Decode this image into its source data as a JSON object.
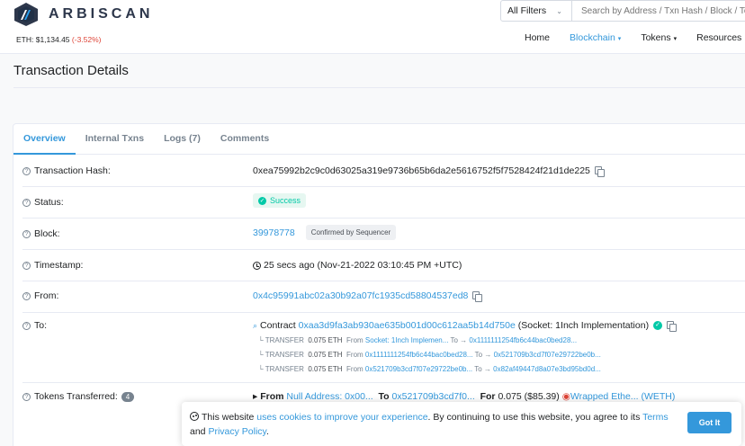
{
  "header": {
    "brand": "ARBISCAN",
    "eth_label": "ETH: $1,134.45",
    "eth_change": "(-3.52%)",
    "filter": "All Filters",
    "search_placeholder": "Search by Address / Txn Hash / Block / Token",
    "nav": [
      {
        "label": "Home"
      },
      {
        "label": "Blockchain"
      },
      {
        "label": "Tokens"
      },
      {
        "label": "Resources"
      }
    ]
  },
  "page": {
    "title": "Transaction Details"
  },
  "tabs": [
    {
      "label": "Overview"
    },
    {
      "label": "Internal Txns"
    },
    {
      "label": "Logs (7)"
    },
    {
      "label": "Comments"
    }
  ],
  "details": {
    "hash_label": "Transaction Hash:",
    "hash": "0xea75992b2c9c0d63025a319e9736b65b6da2e5616752f5f7528424f21d1de225",
    "status_label": "Status:",
    "status": "Success",
    "block_label": "Block:",
    "block": "39978778",
    "block_badge": "Confirmed by Sequencer",
    "timestamp_label": "Timestamp:",
    "timestamp": "25 secs ago (Nov-21-2022 03:10:45 PM +UTC)",
    "from_label": "From:",
    "from": "0x4c95991abc02a30b92a07fc1935cd58804537ed8",
    "to_label": "To:",
    "to_prefix": "Contract",
    "to_address": "0xaa3d9fa3ab930ae635b001d00c612aa5b14d750e",
    "to_name": "(Socket: 1Inch Implementation)",
    "transfers": [
      {
        "prefix": "└ TRANSFER",
        "amount": "0.075 ETH",
        "from_word": "From",
        "from": "Socket: 1Inch Implemen...",
        "to_word": "To →",
        "to": "0x1111111254fb6c44bac0bed28..."
      },
      {
        "prefix": "└ TRANSFER",
        "amount": "0.075 ETH",
        "from_word": "From",
        "from": "0x1111111254fb6c44bac0bed28...",
        "to_word": "To →",
        "to": "0x521709b3cd7f07e29722be0b..."
      },
      {
        "prefix": "└ TRANSFER",
        "amount": "0.075 ETH",
        "from_word": "From",
        "from": "0x521709b3cd7f07e29722be0b...",
        "to_word": "To →",
        "to": "0x82af49447d8a07e3bd95bd0d..."
      }
    ],
    "tokens_label": "Tokens Transferred:",
    "tokens_count": "4",
    "token_from_word": "▸ From",
    "token_from": "Null Address: 0x00...",
    "token_to_word": "To",
    "token_to": "0x521709b3cd7f0...",
    "token_for_word": "For",
    "token_amount": "0.075 ($85.39)",
    "token_name": "Wrapped Ethe... (WETH)"
  },
  "cookie": {
    "text_1": "This website ",
    "link_1": "uses cookies to improve your experience",
    "text_2": ". By continuing to use this website, you agree to its ",
    "link_2": "Terms",
    "text_3": " and ",
    "link_3": "Privacy Policy",
    "text_4": ".",
    "button": "Got It"
  },
  "colors": {
    "accent": "#3498db",
    "success": "#00c9a7",
    "negative": "#de4437"
  }
}
